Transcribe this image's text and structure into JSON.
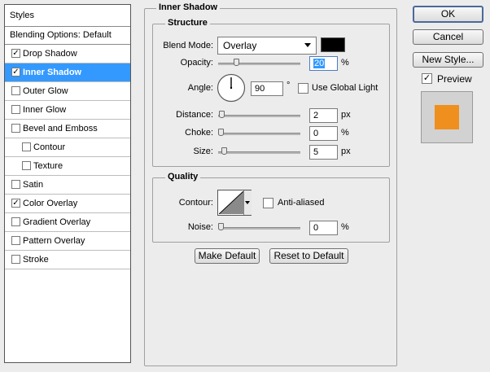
{
  "styles_panel": {
    "header": "Styles",
    "blending_options": "Blending Options: Default",
    "items": [
      {
        "label": "Drop Shadow",
        "checked": true,
        "selected": false,
        "sub": false
      },
      {
        "label": "Inner Shadow",
        "checked": true,
        "selected": true,
        "sub": false
      },
      {
        "label": "Outer Glow",
        "checked": false,
        "selected": false,
        "sub": false
      },
      {
        "label": "Inner Glow",
        "checked": false,
        "selected": false,
        "sub": false
      },
      {
        "label": "Bevel and Emboss",
        "checked": false,
        "selected": false,
        "sub": false
      },
      {
        "label": "Contour",
        "checked": false,
        "selected": false,
        "sub": true
      },
      {
        "label": "Texture",
        "checked": false,
        "selected": false,
        "sub": true
      },
      {
        "label": "Satin",
        "checked": false,
        "selected": false,
        "sub": false
      },
      {
        "label": "Color Overlay",
        "checked": true,
        "selected": false,
        "sub": false
      },
      {
        "label": "Gradient Overlay",
        "checked": false,
        "selected": false,
        "sub": false
      },
      {
        "label": "Pattern Overlay",
        "checked": false,
        "selected": false,
        "sub": false
      },
      {
        "label": "Stroke",
        "checked": false,
        "selected": false,
        "sub": false
      }
    ]
  },
  "inner_shadow": {
    "title": "Inner Shadow",
    "structure": {
      "title": "Structure",
      "blend_mode_label": "Blend Mode:",
      "blend_mode_value": "Overlay",
      "shadow_color": "#000000",
      "opacity_label": "Opacity:",
      "opacity_value": "20",
      "opacity_unit": "%",
      "angle_label": "Angle:",
      "angle_value": "90",
      "angle_unit": "°",
      "global_light_label": "Use Global Light",
      "global_light_checked": false,
      "distance_label": "Distance:",
      "distance_value": "2",
      "distance_unit": "px",
      "choke_label": "Choke:",
      "choke_value": "0",
      "choke_unit": "%",
      "size_label": "Size:",
      "size_value": "5",
      "size_unit": "px"
    },
    "quality": {
      "title": "Quality",
      "contour_label": "Contour:",
      "anti_aliased_label": "Anti-aliased",
      "anti_aliased_checked": false,
      "noise_label": "Noise:",
      "noise_value": "0",
      "noise_unit": "%"
    },
    "make_default_label": "Make Default",
    "reset_default_label": "Reset to Default"
  },
  "actions": {
    "ok_label": "OK",
    "cancel_label": "Cancel",
    "new_style_label": "New Style...",
    "preview_label": "Preview",
    "preview_checked": true,
    "preview_swatch_color": "#ef8f1d"
  }
}
